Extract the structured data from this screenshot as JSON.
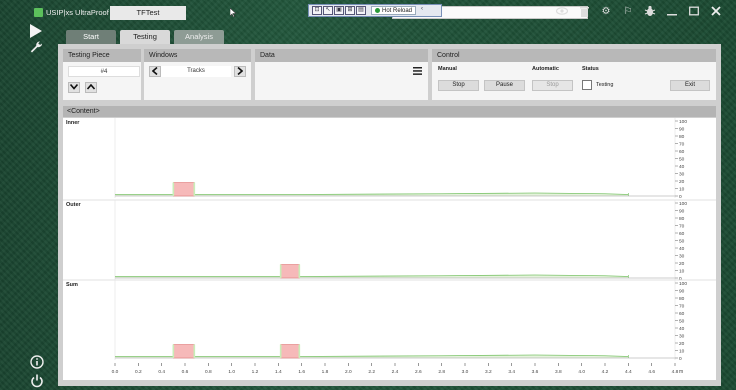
{
  "window": {
    "app_title": "USIP|xs UltraProof",
    "test_name": "TFTest",
    "hot_reload": "Hot Reload"
  },
  "tabs": [
    {
      "label": "Start"
    },
    {
      "label": "Testing"
    },
    {
      "label": "Analysis"
    }
  ],
  "testing_piece": {
    "header": "Testing Piece",
    "value": "#4"
  },
  "windows": {
    "header": "Windows",
    "selected": "Tracks"
  },
  "data_panel": {
    "header": "Data"
  },
  "control": {
    "header": "Control",
    "manual_label": "Manual",
    "automatic_label": "Automatic",
    "status_label": "Status",
    "stop_label": "Stop",
    "pause_label": "Pause",
    "auto_stop_label": "Stop",
    "testing_label": "Testing",
    "exit_label": "Exit"
  },
  "content_title": "<Content>",
  "chart_data": [
    {
      "type": "area",
      "title": "Inner",
      "y_ticks": [
        0,
        10,
        20,
        30,
        40,
        50,
        60,
        70,
        80,
        90,
        100
      ],
      "ylim": [
        0,
        100
      ],
      "x_ticks": [
        0.0,
        0.2,
        0.4,
        0.6,
        0.8,
        1.0,
        1.2,
        1.4,
        1.6,
        1.8,
        2.0,
        2.2,
        2.4,
        2.6,
        2.8,
        3.0,
        3.2,
        3.4,
        3.6,
        3.8,
        4.0,
        4.2,
        4.4,
        4.6,
        4.8
      ],
      "xlim": [
        0.0,
        4.8
      ],
      "xlabel": "m",
      "baseline_end": 4.4,
      "baseline": [
        [
          0.0,
          2
        ],
        [
          1.6,
          2
        ],
        [
          2.8,
          3
        ],
        [
          3.6,
          4
        ],
        [
          4.2,
          3
        ],
        [
          4.4,
          2
        ]
      ],
      "peaks": [
        {
          "x0": 0.5,
          "x1": 0.68,
          "value": 18,
          "color": "#f6b9b9"
        }
      ]
    },
    {
      "type": "area",
      "title": "Outer",
      "y_ticks": [
        0,
        10,
        20,
        30,
        40,
        50,
        60,
        70,
        80,
        90,
        100
      ],
      "ylim": [
        0,
        100
      ],
      "x_ticks": [
        0.0,
        0.2,
        0.4,
        0.6,
        0.8,
        1.0,
        1.2,
        1.4,
        1.6,
        1.8,
        2.0,
        2.2,
        2.4,
        2.6,
        2.8,
        3.0,
        3.2,
        3.4,
        3.6,
        3.8,
        4.0,
        4.2,
        4.4,
        4.6,
        4.8
      ],
      "xlim": [
        0.0,
        4.8
      ],
      "xlabel": "m",
      "baseline_end": 4.4,
      "baseline": [
        [
          0.0,
          2
        ],
        [
          1.6,
          2
        ],
        [
          2.8,
          3
        ],
        [
          3.6,
          4
        ],
        [
          4.2,
          3
        ],
        [
          4.4,
          2
        ]
      ],
      "peaks": [
        {
          "x0": 1.42,
          "x1": 1.58,
          "value": 18,
          "color": "#f6b9b9"
        }
      ]
    },
    {
      "type": "area",
      "title": "Sum",
      "y_ticks": [
        0,
        10,
        20,
        30,
        40,
        50,
        60,
        70,
        80,
        90,
        100
      ],
      "ylim": [
        0,
        100
      ],
      "x_ticks": [
        0.0,
        0.2,
        0.4,
        0.6,
        0.8,
        1.0,
        1.2,
        1.4,
        1.6,
        1.8,
        2.0,
        2.2,
        2.4,
        2.6,
        2.8,
        3.0,
        3.2,
        3.4,
        3.6,
        3.8,
        4.0,
        4.2,
        4.4,
        4.6,
        4.8
      ],
      "xlim": [
        0.0,
        4.8
      ],
      "xlabel": "m",
      "baseline_end": 4.4,
      "baseline": [
        [
          0.0,
          2
        ],
        [
          1.6,
          2
        ],
        [
          2.8,
          3
        ],
        [
          3.6,
          4
        ],
        [
          4.2,
          3
        ],
        [
          4.4,
          2
        ]
      ],
      "peaks": [
        {
          "x0": 0.5,
          "x1": 0.68,
          "value": 18,
          "color": "#f6b9b9"
        },
        {
          "x0": 1.42,
          "x1": 1.58,
          "value": 18,
          "color": "#f6b9b9"
        }
      ]
    }
  ],
  "colors": {
    "baseline_fill": "#e4f2dc",
    "baseline_line": "#7cc46a",
    "peak_edge": "#e07878",
    "peak_green": "#c8eeb8"
  }
}
